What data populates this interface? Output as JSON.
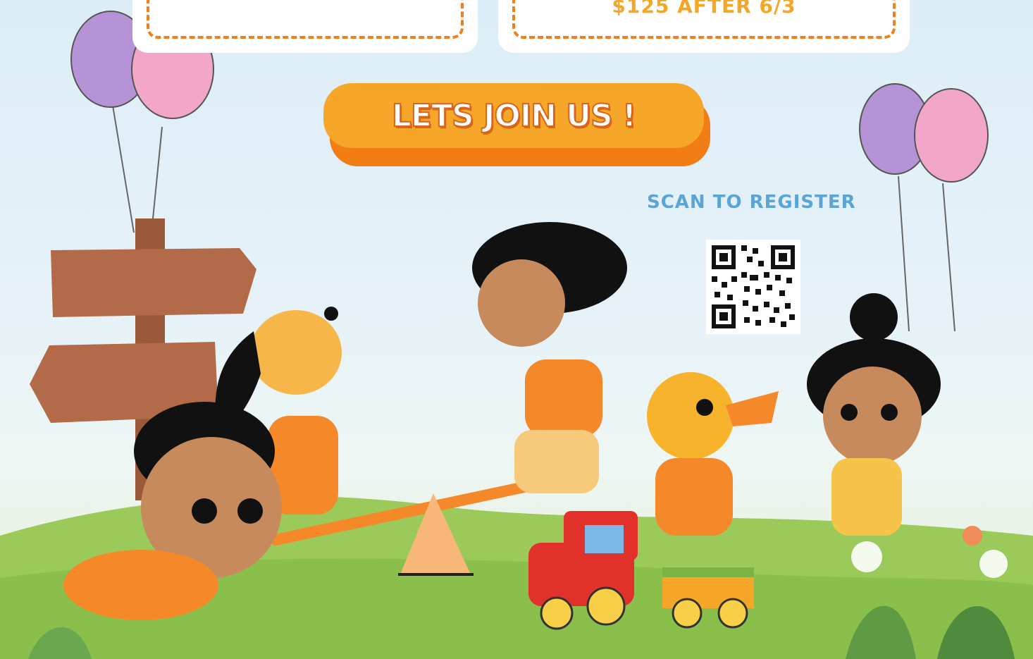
{
  "cards": [
    {
      "text": ""
    },
    {
      "text": "$125 AFTER 6/3"
    }
  ],
  "cta": {
    "label": "LETS JOIN US !"
  },
  "register": {
    "label": "SCAN TO REGISTER"
  },
  "colors": {
    "accent_orange": "#f6a629",
    "dark_orange": "#f27d14",
    "scan_blue": "#5aa5d6",
    "grass_green": "#8bc34a"
  },
  "icons": [
    "balloon-icon",
    "signpost-icon",
    "qr-code-icon",
    "seesaw-icon",
    "toy-train-icon",
    "flower-icon"
  ]
}
